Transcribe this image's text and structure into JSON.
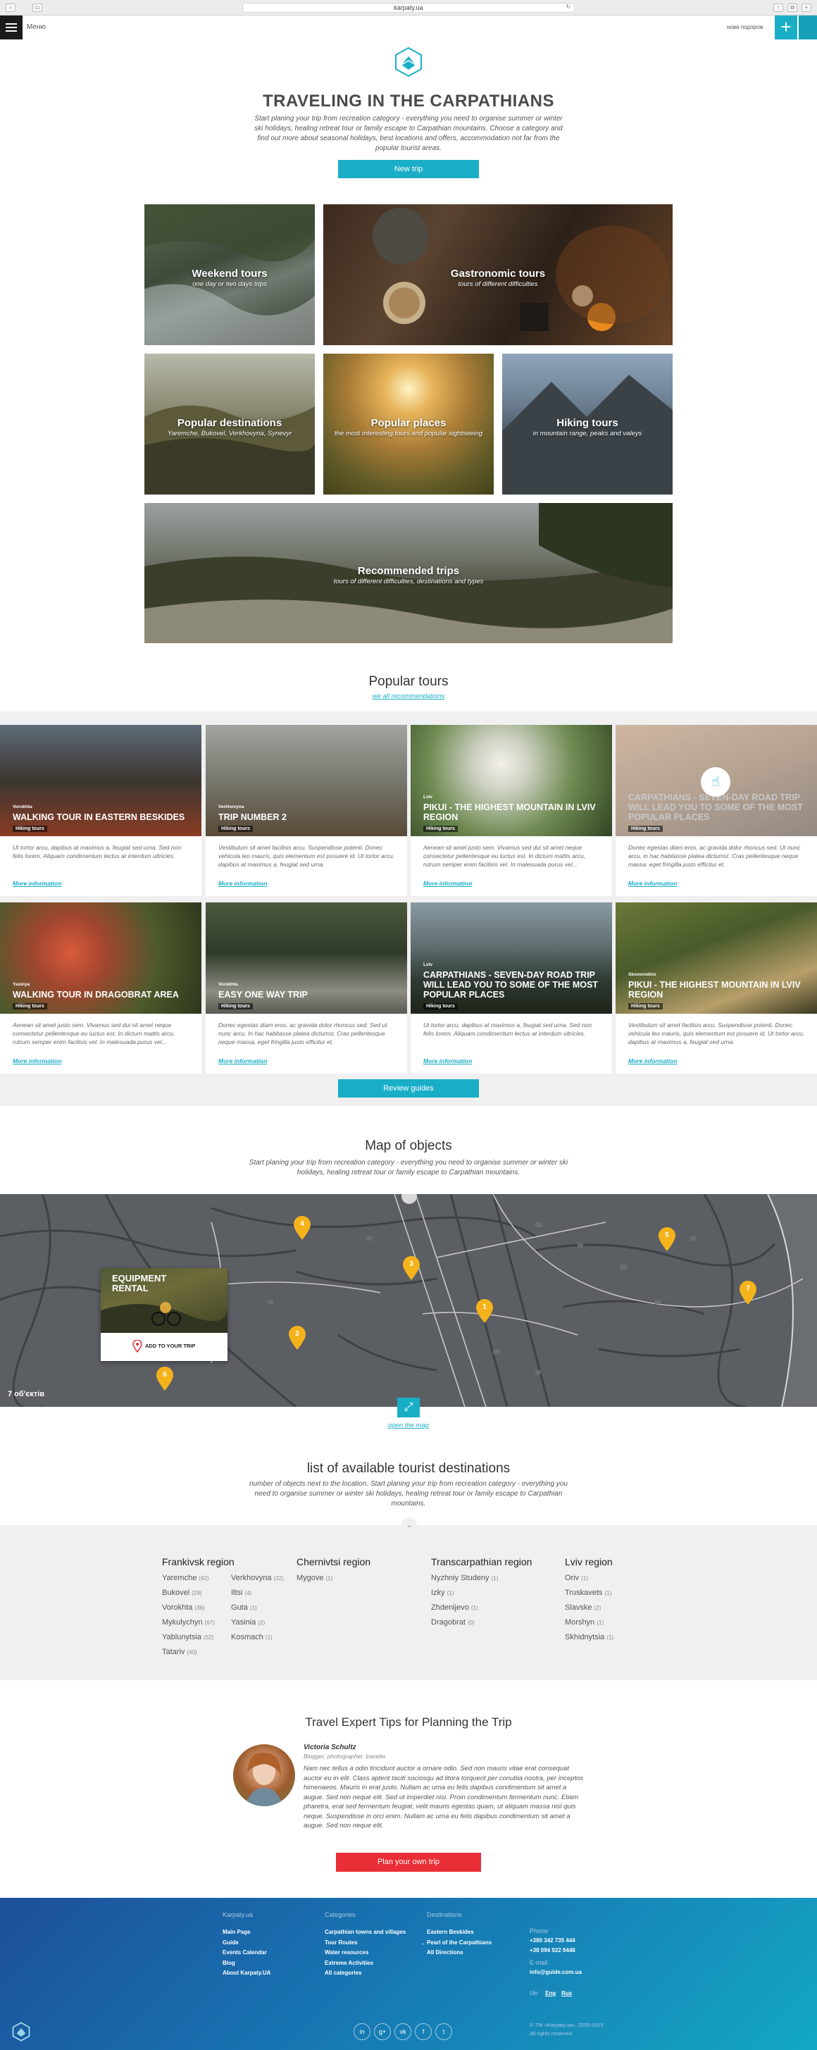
{
  "browser": {
    "url": "karpaty.ua"
  },
  "topbar": {
    "menu_label": "Меню",
    "new_trip_label": "нова подорож",
    "plus_icon": "+"
  },
  "hero": {
    "title": "TRAVELING IN THE CARPATHIANS",
    "intro": "Start planing your trip from recreation category - everything you need to organise summer or winter ski holidays, healing retreat tour or family escape to Carpathian mountains. Choose a category and find out more about seasonal holidays, best locations and offers, accommodation not far from the popular tourist areas.",
    "button": "New trip"
  },
  "categories": [
    {
      "title": "Weekend tours",
      "subtitle": "one day or two days trips"
    },
    {
      "title": "Gastronomic tours",
      "subtitle": "tours of different difficulties"
    },
    {
      "title": "Popular destinations",
      "subtitle": "Yaremche, Bukovel, Verkhovyna, Synevyr"
    },
    {
      "title": "Popular places",
      "subtitle": "the most interesting tours and popular sightseeing"
    },
    {
      "title": "Hiking tours",
      "subtitle": "in mountain range, peaks and valeys"
    },
    {
      "title": "Recommended trips",
      "subtitle": "tours of different difficulties, destinations and types"
    }
  ],
  "popular": {
    "title": "Popular tours",
    "link": "we all recommendations",
    "more_label": "More information",
    "cards": [
      {
        "loc": "Vorokhta",
        "title": "WALKING TOUR IN EASTERN BESKIDES",
        "tag": "Hiking tours",
        "desc": "Ut tortor arcu, dapibus at maximus a, feugiat sed urna. Sed non felis lorem. Aliquam condimentum lectus at interdum ultricies."
      },
      {
        "loc": "Verkhovyna",
        "title": "TRIP NUMBER 2",
        "tag": "Hiking tours",
        "desc": "Vestibulum sit amet facilisis arcu. Suspendisse potenti. Donec vehicula leo mauris, quis elementum est posuere id. Ut tortor arcu, dapibus at maximus a, feugiat sed urna."
      },
      {
        "loc": "Lviv",
        "title": "PIKUI - THE HIGHEST MOUNTAIN IN LVIV REGION",
        "tag": "Hiking tours",
        "desc": "Aenean sit amet justo sem. Vivamus sed dui sit amet neque consectetur pellentesque eu luctus est. In dictum mattis arcu, rutrum semper enim facilisis vel. In malesuada purus vel..."
      },
      {
        "loc": "",
        "title": "CARPATHIANS - SEVEN-DAY ROAD TRIP WILL LEAD YOU TO SOME OF THE MOST POPULAR PLACES",
        "tag": "Hiking tours",
        "desc": "Donec egestas diam eros, ac gravida dolor rhoncus sed. Ut nunc arcu, in hac habitasse platea dictumst. Cras pellentesque neque massa, eget fringilla justo efficitur et."
      },
      {
        "loc": "Yasinya",
        "title": "WALKING TOUR IN DRAGOBRAT AREA",
        "tag": "Hiking tours",
        "desc": "Aenean sit amet justo sem. Vivamus sed dui sit amet neque consectetur pellentesque eu luctus est. In dictum mattis arcu, rutrum semper enim facilisis vel. In malesuada purus vel..."
      },
      {
        "loc": "Vorokhta",
        "title": "EASY ONE WAY TRIP",
        "tag": "Hiking tours",
        "desc": "Donec egestas diam eros, ac gravida dolor rhoncus sed. Sed ut nunc arcu. In hac habitasse platea dictumst. Cras pellentesque neque massa, eget fringilla justo efficitur et."
      },
      {
        "loc": "Lviv",
        "title": "CARPATHIANS - SEVEN-DAY ROAD TRIP WILL LEAD YOU TO SOME OF THE MOST POPULAR PLACES",
        "tag": "Hiking tours",
        "desc": "Ut tortor arcu, dapibus at maximus a, feugiat sed urna. Sed non felis lorem. Aliquam condimentum lectus at interdum ultricies."
      },
      {
        "loc": "Skovorodino",
        "title": "PIKUI - THE HIGHEST MOUNTAIN IN LVIV REGION",
        "tag": "Hiking tours",
        "desc": "Vestibulum sit amet facilisis arcu. Suspendisse potenti. Donec vehicula leo mauris, quis elementum est posuere id. Ut tortor arcu, dapibus at maximus a, feugiat sed urna."
      }
    ],
    "button": "Review guides"
  },
  "map": {
    "title": "Map of objects",
    "intro": "Start planing your trip from recreation category - everything you need to organise summer or winter ski holidays, healing retreat tour or family escape to Carpathian mountains.",
    "count": "7 об'єктів",
    "open_link": "open the map",
    "popup_title": "EQUIPMENT RENTAL",
    "popup_button": "ADD TO YOUR TRIP",
    "pins": [
      "4",
      "3",
      "5",
      "7",
      "1",
      "2",
      "6"
    ]
  },
  "destinations": {
    "title": "list of available tourist destinations",
    "intro": "number of objects next to the location. Start planing your trip from recreation category - everything you need to organise summer or winter ski holidays, healing retreat tour or family escape to Carpathian mountains.",
    "regions": [
      {
        "name": "Frankivsk region",
        "col1": [
          [
            "Yaremche",
            "(42)"
          ],
          [
            "Bukovel",
            "(29)"
          ],
          [
            "Vorokhta",
            "(36)"
          ],
          [
            "Mykulychyn",
            "(67)"
          ],
          [
            "Yablunytsia",
            "(52)"
          ],
          [
            "Tatariv",
            "(40)"
          ]
        ],
        "col2": [
          [
            "Verkhovyna",
            "(22)"
          ],
          [
            "Iltsi",
            "(4)"
          ],
          [
            "Guta",
            "(1)"
          ],
          [
            "Yasinia",
            "(2)"
          ],
          [
            "Kosmach",
            "(1)"
          ]
        ]
      },
      {
        "name": "Chernivtsi region",
        "col1": [
          [
            "Mygove",
            "(1)"
          ]
        ],
        "col2": []
      },
      {
        "name": "Transcarpathian region",
        "col1": [
          [
            "Nyzhniy Studeny",
            "(1)"
          ],
          [
            "Izky",
            "(1)"
          ],
          [
            "Zhdenijevo",
            "(1)"
          ],
          [
            "Dragobrat",
            "(0)"
          ]
        ],
        "col2": []
      },
      {
        "name": "Lviv region",
        "col1": [
          [
            "Oriv",
            "(1)"
          ],
          [
            "Truskavets",
            "(1)"
          ],
          [
            "Slavske",
            "(2)"
          ],
          [
            "Morshyn",
            "(1)"
          ],
          [
            "Skhidnytsia",
            "(1)"
          ]
        ],
        "col2": []
      }
    ]
  },
  "tips": {
    "title": "Travel Expert Tips for Planning the Trip",
    "author": "Victoria Schultz",
    "role": "Blogger, photographer, traveler",
    "text": "Nam nec tellus a odio tincidunt auctor a ornare odio. Sed non mauris vitae erat consequat auctor eu in elit. Class aptent taciti sociosqu ad litora torquent per conubia nostra, per inceptos himenaeos. Mauris in erat justo. Nullam ac urna eu felis dapibus condimentum sit amet a augue. Sed non neque elit. Sed ut imperdiet nisi. Proin condimentum fermentum nunc. Etiam pharetra, erat sed fermentum feugiat, velit mauris egestas quam, ut aliquam massa nisl quis neque. Suspendisse in orci enim. Nullam ac urna eu felis dapibus condimentum sit amet a augue. Sed non neque elit.",
    "button": "Plan your own trip"
  },
  "footer": {
    "col1_title": "Karpaty.ua",
    "col1": [
      "Main Page",
      "Guide",
      "Events Calendar",
      "Blog",
      "About Karpaty.UA"
    ],
    "col2_title": "Categories",
    "col2": [
      "Carpathian towns and villages",
      "Tour Routes",
      "Water resources",
      "Extreme Activities",
      "All categories"
    ],
    "col3_title": "Destinations",
    "col3": [
      "Eastern Beskides",
      "Pearl of the Carpathians",
      "All Directions"
    ],
    "phone_label": "Phone",
    "phones": [
      "+380 342 735 444",
      "+38 094 922 9448"
    ],
    "email_label": "E-mail",
    "email": "info@guide.com.ua",
    "lang_label": "Ukr",
    "lang_eng": "Eng",
    "lang_rus": "Rus",
    "copyright": "© ТМ «Karpaty.ua», 2005-2015",
    "rights": "All rights reserved",
    "social": [
      "in",
      "g+",
      "vk",
      "f",
      "t"
    ]
  }
}
